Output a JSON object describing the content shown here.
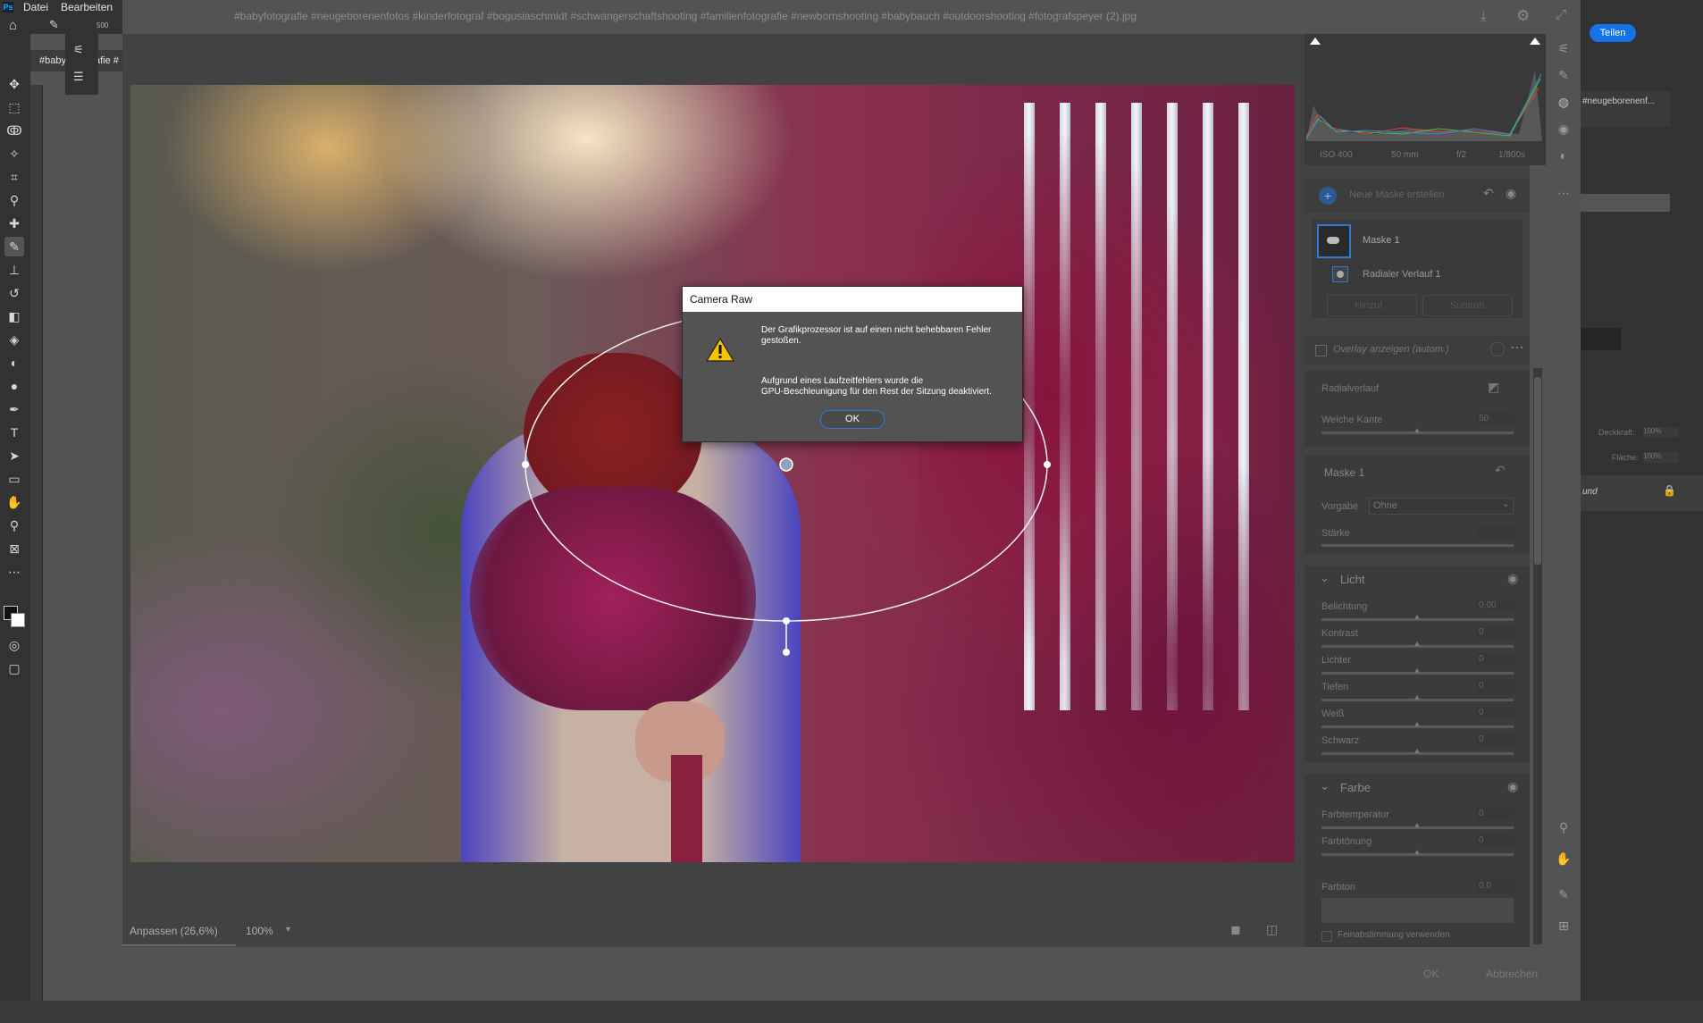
{
  "menubar": {
    "app_logo": "Ps",
    "items": [
      "Datei",
      "Bearbeiten"
    ]
  },
  "toolbar_options": {
    "brush_size": "500"
  },
  "document_tab": {
    "label": "#baby",
    "label2": "afie #"
  },
  "camera_raw": {
    "file_title": "#babyfotografie #neugeborenenfotos #kinderfotograf #bogusiaschmidt #schwangerschaftshooting #familienfotografie #newbornshooting #babybauch #outdoorshooting #fotografspeyer (2).jpg",
    "exif": {
      "iso": "ISO 400",
      "focal": "50 mm",
      "aperture": "f/2",
      "shutter": "1/800s"
    },
    "masks": {
      "new_mask_label": "Neue Maske erstellen",
      "mask_name": "Maske 1",
      "component": "Radialer Verlauf 1",
      "add_label": "Hinzuf.",
      "subtract_label": "Subtrah.",
      "overlay_label": "Overlay anzeigen (autom.)"
    },
    "radial": {
      "title": "Radialverlauf",
      "feather_label": "Weiche Kante",
      "feather_value": "50"
    },
    "mask_section": {
      "title": "Maske 1",
      "preset_label": "Vorgabe",
      "preset_value": "Ohne",
      "amount_label": "Stärke"
    },
    "light": {
      "title": "Licht",
      "rows": [
        {
          "label": "Belichtung",
          "value": "0,00"
        },
        {
          "label": "Kontrast",
          "value": "0"
        },
        {
          "label": "Lichter",
          "value": "0"
        },
        {
          "label": "Tiefen",
          "value": "0"
        },
        {
          "label": "Weiß",
          "value": "0"
        },
        {
          "label": "Schwarz",
          "value": "0"
        }
      ]
    },
    "color": {
      "title": "Farbe",
      "rows": [
        {
          "label": "Farbtemperatur",
          "value": "0"
        },
        {
          "label": "Farbtönung",
          "value": "0"
        }
      ],
      "hue_label": "Farbton",
      "hue_value": "0,0",
      "fine_tune_label": "Feinabstimmung verwenden"
    },
    "bottom": {
      "fit_label": "Anpassen (26,6%)",
      "zoom_label": "100%",
      "ok_label": "OK",
      "cancel_label": "Abbrechen"
    }
  },
  "dialog": {
    "title": "Camera Raw",
    "message1": "Der Grafikprozessor ist auf einen nicht behebbaren Fehler gestoßen.",
    "message2": "Aufgrund eines Laufzeitfehlers wurde die\nGPU-Beschleunigung für den Rest der Sitzung deaktiviert.",
    "ok_label": "OK"
  },
  "ps_dock": {
    "share_label": "Teilen",
    "layer_name": "#neugeborenenf...",
    "opacity_label": "Deckkraft:",
    "opacity_value": "100%",
    "fill_label": "Fläche:",
    "fill_value": "100%",
    "background_layer": "und"
  },
  "colors": {
    "accent": "#1473e6",
    "dialog_button_border": "#2d7ad6",
    "panel": "#424242",
    "chrome": "#323232"
  }
}
